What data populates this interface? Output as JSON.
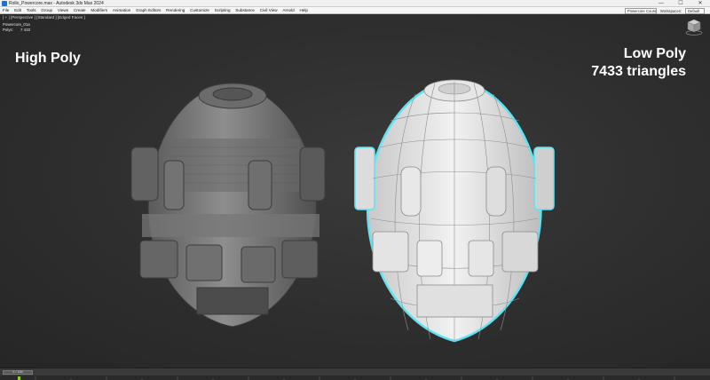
{
  "window": {
    "title": "Rollo_Powercore.max - Autodesk 3ds Max 2024",
    "controls": {
      "minimize": "—",
      "maximize": "☐",
      "close": "✕"
    }
  },
  "menu": {
    "items": [
      "File",
      "Edit",
      "Tools",
      "Group",
      "Views",
      "Create",
      "Modifiers",
      "Animation",
      "Graph Editors",
      "Rendering",
      "Customize",
      "Scripting",
      "Substance",
      "Civil View",
      "Arnold",
      "Help"
    ],
    "command_field": "Powercore Cours...",
    "workspaces_label": "Workspaces:",
    "workspace_value": "Default"
  },
  "viewport": {
    "label": "[ + ] [Perspective ] [Standard ] [Edged Faces ]",
    "stats": {
      "object_name": "Powercore_01a",
      "polys_label": "Polys:",
      "polys_value": "7 433"
    },
    "high_poly_label": "High Poly",
    "low_poly_label": "Low Poly",
    "triangle_count": "7433 triangles"
  },
  "timeline": {
    "slider_text": "0 / 100"
  },
  "colors": {
    "highlight": "#5fe3f2",
    "viewport_bg": "#2e2e2e",
    "mesh": "#8a8a8a",
    "lowpoly": "#e8e8e8"
  },
  "icons": {
    "viewcube": "viewcube-icon",
    "app": "max-app-icon"
  }
}
